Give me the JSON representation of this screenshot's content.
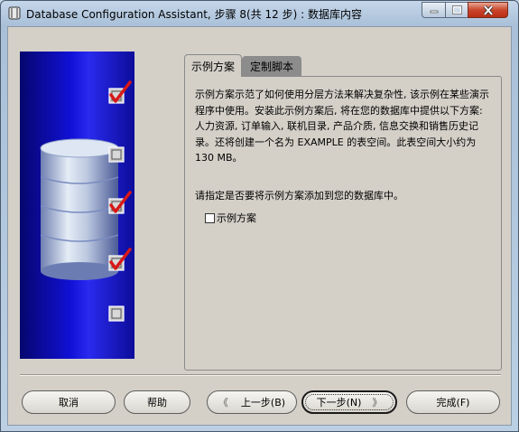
{
  "window": {
    "title": "Database Configuration Assistant, 步骤 8(共 12 步) : 数据库内容"
  },
  "tabs": [
    {
      "label": "示例方案",
      "active": true
    },
    {
      "label": "定制脚本",
      "active": false
    }
  ],
  "content": {
    "description": "示例方案示范了如何使用分层方法来解决复杂性, 该示例在某些演示程序中使用。安装此示例方案后, 将在您的数据库中提供以下方案: 人力资源, 订单输入, 联机目录, 产品介质, 信息交换和销售历史记录。还将创建一个名为 EXAMPLE 的表空间。此表空间大小约为 130 MB。",
    "prompt": "请指定是否要将示例方案添加到您的数据库中。",
    "checkbox_label": "示例方案",
    "checkbox_checked": false
  },
  "steps_checks": [
    true,
    false,
    true,
    true,
    false
  ],
  "buttons": {
    "cancel": "取消",
    "help": "帮助",
    "back": "上一步(B)",
    "next": "下一步(N)",
    "finish": "完成(F)"
  },
  "colors": {
    "panel_blue": "#1111d8",
    "check_red": "#d81818",
    "close_red": "#c9462d"
  }
}
